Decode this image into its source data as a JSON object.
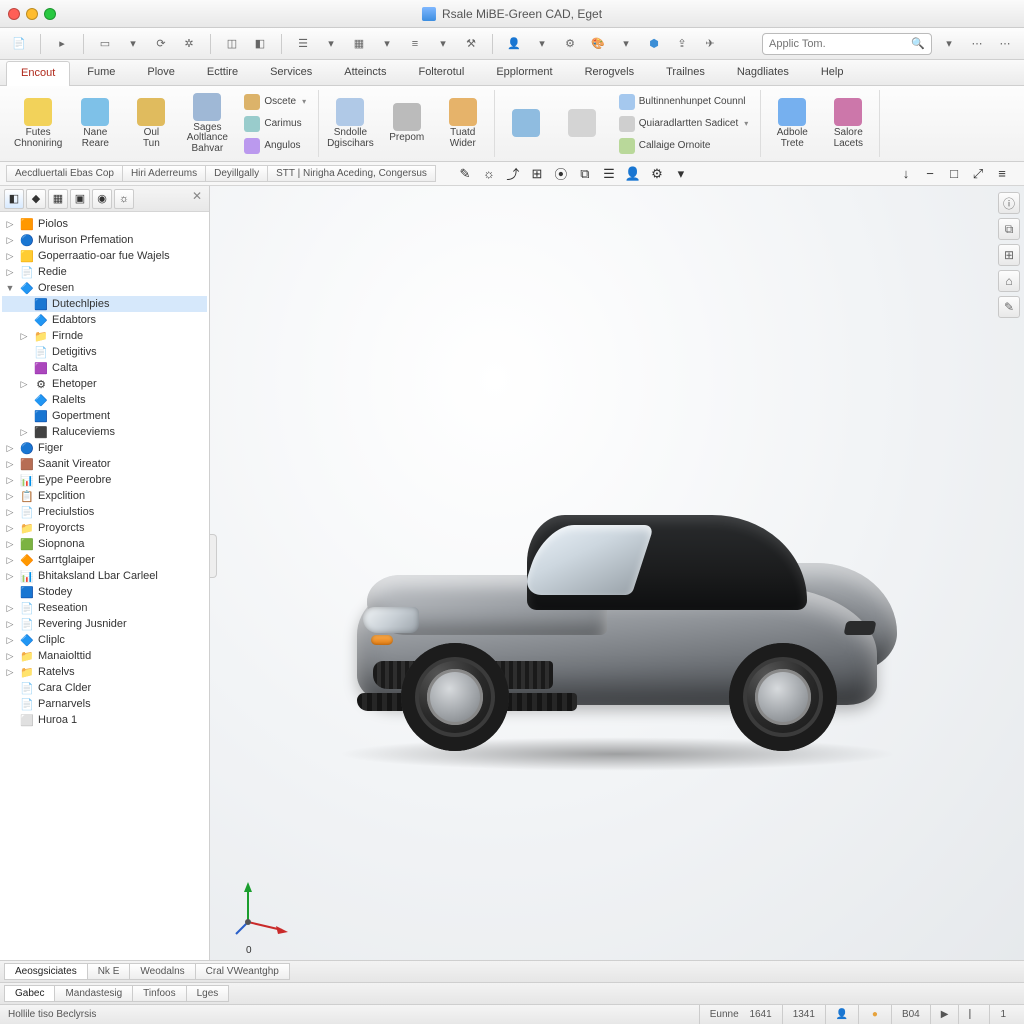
{
  "title": "Rsale MiBE-Green CAD, Eget",
  "search": {
    "placeholder": "Applic Tom."
  },
  "menutabs": [
    "Encout",
    "Fume",
    "Plove",
    "Ecttire",
    "Services",
    "Atteincts",
    "Folterotul",
    "Epplorment",
    "Rerogvels",
    "Trailnes",
    "Nagdliates",
    "Help"
  ],
  "active_tab_index": 0,
  "ribbon": {
    "groups": [
      {
        "big": [
          {
            "label": "Futes\nChnoniring",
            "color": "#f2d25a"
          },
          {
            "label": "Nane\nReare",
            "color": "#7ec1e8"
          },
          {
            "label": "Oul\nTun",
            "color": "#e0bb5e"
          },
          {
            "label": "Sages\nAoltlance\nBahvar",
            "color": "#9fb8d6"
          }
        ],
        "small": [
          {
            "label": "Oscete",
            "hasdd": true,
            "color": "#dcb36a"
          },
          {
            "label": "Carimus",
            "color": "#9cc"
          },
          {
            "label": "Angulos",
            "color": "#b9e"
          }
        ]
      },
      {
        "big": [
          {
            "label": "Sndolle\nDgiscihars",
            "color": "#b0c9e7"
          },
          {
            "label": "Prepom",
            "color": "#bbb"
          },
          {
            "label": "Tuatd\nWider",
            "color": "#e6b36a"
          }
        ]
      },
      {
        "big": [
          {
            "label": "",
            "color": "#8fbce0"
          },
          {
            "label": "",
            "color": "#d4d4d4"
          }
        ],
        "small": [
          {
            "label": "Bultinnenhunpet Counnl",
            "color": "#a5c8ee"
          },
          {
            "label": "Quiaradlartten Sadicet",
            "hasdd": true,
            "color": "#cfcfcf"
          },
          {
            "label": "Callaige Ornoite",
            "color": "#b9d89a"
          }
        ]
      },
      {
        "big": [
          {
            "label": "Adbole\nTrete",
            "color": "#76b0ef"
          },
          {
            "label": "Salore\nLacets",
            "color": "#c7a"
          }
        ]
      }
    ]
  },
  "breadcrumbs": [
    "Aecdluertali Ebas Cop",
    "Hiri Aderreums",
    "Deyillgally",
    "STT | Nirigha Aceding, Congersus"
  ],
  "viewport_tools": [
    "✎",
    "☼",
    "⤴",
    "⊞",
    "⦿",
    "⧉",
    "☰",
    "👤",
    "⚙",
    "▾"
  ],
  "right_tools": [
    "↓",
    "−",
    "□",
    "⤢",
    "≡"
  ],
  "right_rail": [
    "ⓘ",
    "⧉",
    "⊞",
    "⌂",
    "✎"
  ],
  "sidebar_tabs": [
    "◧",
    "◆",
    "▦",
    "▣",
    "◉",
    "☼"
  ],
  "tree": [
    {
      "label": "Piolos",
      "twist": "▷",
      "icon": "🟧",
      "indent": 0
    },
    {
      "label": "Murison Prfemation",
      "twist": "▷",
      "icon": "🔵",
      "indent": 0
    },
    {
      "label": "Goperraatio-oar fue Wajels",
      "twist": "▷",
      "icon": "🟨",
      "indent": 0
    },
    {
      "label": "Redie",
      "twist": "▷",
      "icon": "📄",
      "indent": 0
    },
    {
      "label": "Oresen",
      "twist": "▼",
      "icon": "🔷",
      "indent": 0
    },
    {
      "label": "Dutechlpies",
      "twist": "",
      "icon": "🟦",
      "indent": 1,
      "selected": true
    },
    {
      "label": "Edabtors",
      "twist": "",
      "icon": "🔷",
      "indent": 1
    },
    {
      "label": "Firnde",
      "twist": "▷",
      "icon": "📁",
      "indent": 1
    },
    {
      "label": "Detigitivs",
      "twist": "",
      "icon": "📄",
      "indent": 1
    },
    {
      "label": "Calta",
      "twist": "",
      "icon": "🟪",
      "indent": 1
    },
    {
      "label": "Ehetoper",
      "twist": "▷",
      "icon": "⚙",
      "indent": 1
    },
    {
      "label": "Ralelts",
      "twist": "",
      "icon": "🔷",
      "indent": 1
    },
    {
      "label": "Gopertment",
      "twist": "",
      "icon": "🟦",
      "indent": 1
    },
    {
      "label": "Raluceviems",
      "twist": "▷",
      "icon": "⬛",
      "indent": 1
    },
    {
      "label": "Figer",
      "twist": "▷",
      "icon": "🔵",
      "indent": 0
    },
    {
      "label": "Saanit Vireator",
      "twist": "▷",
      "icon": "🟫",
      "indent": 0
    },
    {
      "label": "Eype Peerobre",
      "twist": "▷",
      "icon": "📊",
      "indent": 0
    },
    {
      "label": "Expclition",
      "twist": "▷",
      "icon": "📋",
      "indent": 0
    },
    {
      "label": "Preciulstios",
      "twist": "▷",
      "icon": "📄",
      "indent": 0
    },
    {
      "label": "Proyorcts",
      "twist": "▷",
      "icon": "📁",
      "indent": 0
    },
    {
      "label": "Siopnona",
      "twist": "▷",
      "icon": "🟩",
      "indent": 0
    },
    {
      "label": "Sarrtglaiper",
      "twist": "▷",
      "icon": "🔶",
      "indent": 0
    },
    {
      "label": "Bhitaksland Lbar Carleel",
      "twist": "▷",
      "icon": "📊",
      "indent": 0
    },
    {
      "label": "Stodey",
      "twist": "",
      "icon": "🟦",
      "indent": 0
    },
    {
      "label": "Reseation",
      "twist": "▷",
      "icon": "📄",
      "indent": 0
    },
    {
      "label": "Revering Jusnider",
      "twist": "▷",
      "icon": "📄",
      "indent": 0
    },
    {
      "label": "Cliplc",
      "twist": "▷",
      "icon": "🔷",
      "indent": 0
    },
    {
      "label": "Manaiolttid",
      "twist": "▷",
      "icon": "📁",
      "indent": 0
    },
    {
      "label": "Ratelvs",
      "twist": "▷",
      "icon": "📁",
      "indent": 0
    },
    {
      "label": "Cara Clder",
      "twist": "",
      "icon": "📄",
      "indent": 0
    },
    {
      "label": "Parnarvels",
      "twist": "",
      "icon": "📄",
      "indent": 0
    },
    {
      "label": "Huroa 1",
      "twist": "",
      "icon": "⬜",
      "indent": 0
    }
  ],
  "bottom_tabs_1": [
    "Aeosgsiciates",
    "Nk E",
    "Weodalns",
    "Cral VWeantghp"
  ],
  "bottom_tabs_2": [
    "Gabec",
    "Mandastesig",
    "Tinfoos",
    "Lges"
  ],
  "status": {
    "left": "Hollile tiso Beclyrsis",
    "frame_label": "Eunne",
    "frame": "1641",
    "val2": "1341",
    "val3": "B04",
    "end": "1"
  },
  "origin_label": "0"
}
